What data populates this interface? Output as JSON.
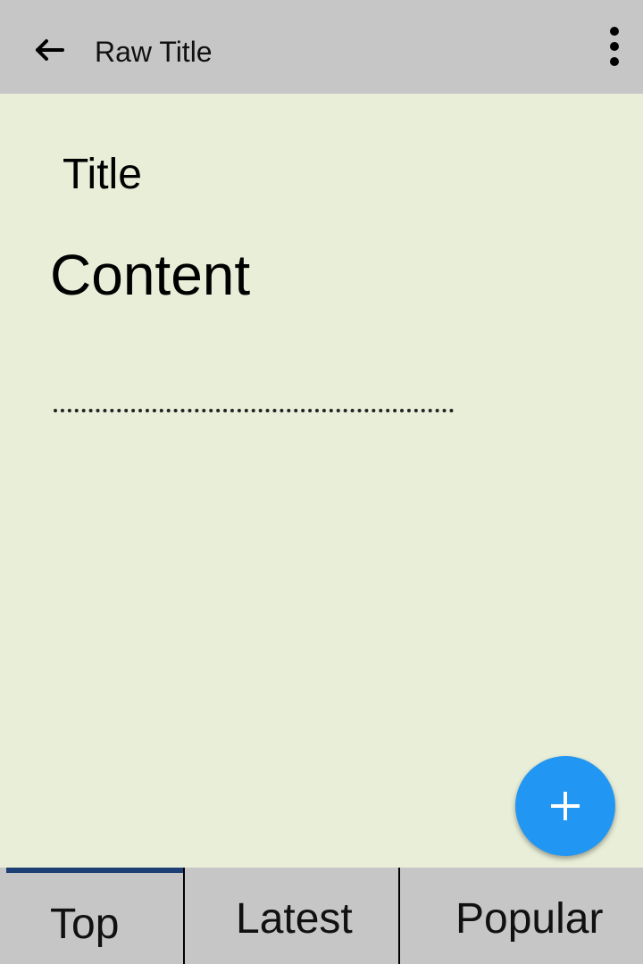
{
  "app_bar": {
    "back_icon": "arrow-left-icon",
    "title": "Raw Title",
    "overflow_icon": "more-vert-icon"
  },
  "content": {
    "title": "Title",
    "body": "Content"
  },
  "fab": {
    "icon": "plus-icon",
    "color": "#2196f3"
  },
  "tabs": [
    {
      "label": "Top",
      "selected": true
    },
    {
      "label": "Latest",
      "selected": false
    },
    {
      "label": "Popular",
      "selected": false
    }
  ],
  "colors": {
    "app_bar_background": "#c6c6c6",
    "content_background": "#e8eed7",
    "tab_indicator": "#1e3f73"
  }
}
